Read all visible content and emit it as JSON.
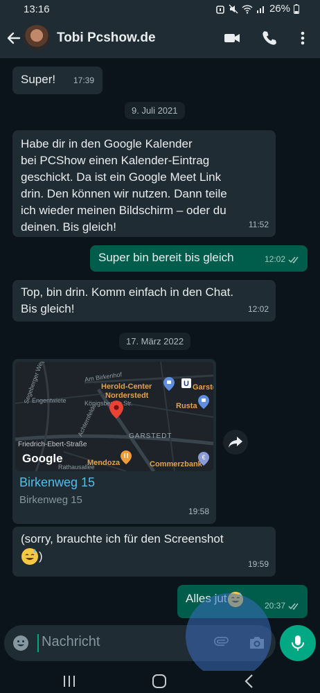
{
  "status": {
    "time": "13:16",
    "battery": "26%"
  },
  "header": {
    "contact_name": "Tobi Pcshow.de"
  },
  "messages": {
    "m1": {
      "text": "Super!",
      "time": "17:39"
    },
    "date1": "9. Juli 2021",
    "m2": {
      "lines": [
        "Habe dir in den Google Kalender",
        "bei PCShow einen Kalender-Eintrag",
        "geschickt. Da ist ein Google Meet Link",
        "drin. Den können wir nutzen. Dann teile",
        "ich wieder meinen Bildschirm – oder du",
        "deinen. Bis gleich!"
      ],
      "time": "11:52"
    },
    "m3": {
      "text": "Super bin bereit bis gleich",
      "time": "12:02"
    },
    "m4": {
      "lines": [
        "Top, bin drin. Komm einfach in den Chat.",
        "Bis gleich!"
      ],
      "time": "12:02"
    },
    "date2": "17. März 2022",
    "m5": {
      "map": {
        "streets": [
          "Segeberger Weg",
          "Am Birkenhof",
          "Engentwiete",
          "Königsberger Str.",
          "Achternfelde",
          "Friedrich-Ebert-Straße",
          "Rathausallee"
        ],
        "district": "GARSTEDT",
        "pois": {
          "herold_line1": "Herold-Center",
          "herold_line2": "Norderstedt",
          "garstedt_station": "Garste",
          "rusta": "Rusta",
          "mendoza": "Mendoza",
          "commerzbank": "Commerzbank"
        },
        "logo": "Google"
      },
      "title": "Birkenweg 15",
      "subtitle": "Birkenweg 15",
      "time": "19:58"
    },
    "m6": {
      "line1": "(sorry, brauchte ich für den Screenshot",
      "line2": ")",
      "time": "19:59"
    },
    "m7": {
      "text": "Alles jut",
      "time": "20:37"
    }
  },
  "composer": {
    "placeholder": "Nachricht"
  },
  "colors": {
    "incoming": "#202c33",
    "outgoing": "#005c4b",
    "accent": "#00a884",
    "link": "#53bdeb"
  }
}
